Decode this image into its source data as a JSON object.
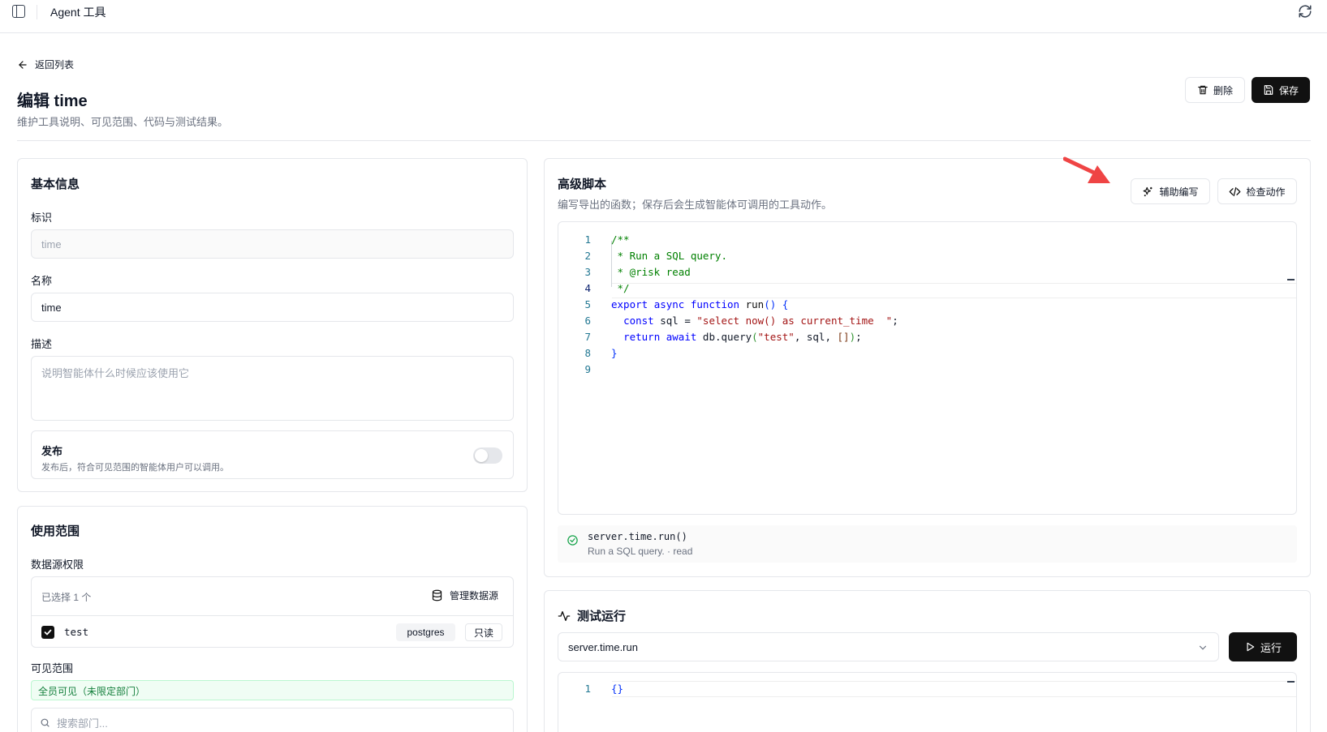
{
  "app": {
    "title": "Agent 工具"
  },
  "header": {
    "back_label": "返回列表",
    "title": "编辑 time",
    "subtitle": "维护工具说明、可见范围、代码与测试结果。",
    "delete_label": "删除",
    "save_label": "保存"
  },
  "basic_info": {
    "title": "基本信息",
    "id_label": "标识",
    "id_placeholder": "time",
    "name_label": "名称",
    "name_value": "time",
    "desc_label": "描述",
    "desc_placeholder": "说明智能体什么时候应该使用它",
    "publish_label": "发布",
    "publish_hint": "发布后，符合可见范围的智能体用户可以调用。",
    "publish_enabled": false
  },
  "scope": {
    "title": "使用范围",
    "datasource_label": "数据源权限",
    "selected_count": "已选择 1 个",
    "manage_label": "管理数据源",
    "datasources": [
      {
        "name": "test",
        "type": "postgres",
        "mode": "只读",
        "checked": true
      }
    ],
    "visibility_label": "可见范围",
    "visibility_value": "全员可见（未限定部门）",
    "dept_search_placeholder": "搜索部门..."
  },
  "script": {
    "title": "高级脚本",
    "subtitle": "编写导出的函数；保存后会生成智能体可调用的工具动作。",
    "assist_label": "辅助编写",
    "check_label": "检查动作",
    "line_numbers": [
      "1",
      "2",
      "3",
      "4",
      "5",
      "6",
      "7",
      "8",
      "9"
    ],
    "action_signature": "server.time.run()",
    "action_meta": "Run a SQL query. · read"
  },
  "test_run": {
    "title": "测试运行",
    "selected_action": "server.time.run",
    "run_label": "运行",
    "input_line_numbers": [
      "1"
    ],
    "input_code": "{}"
  },
  "colors": {
    "primary": "#111111",
    "border": "#e5e7eb",
    "muted": "#6b7280",
    "success": "#16a34a",
    "annotation_arrow": "#ef4444"
  }
}
